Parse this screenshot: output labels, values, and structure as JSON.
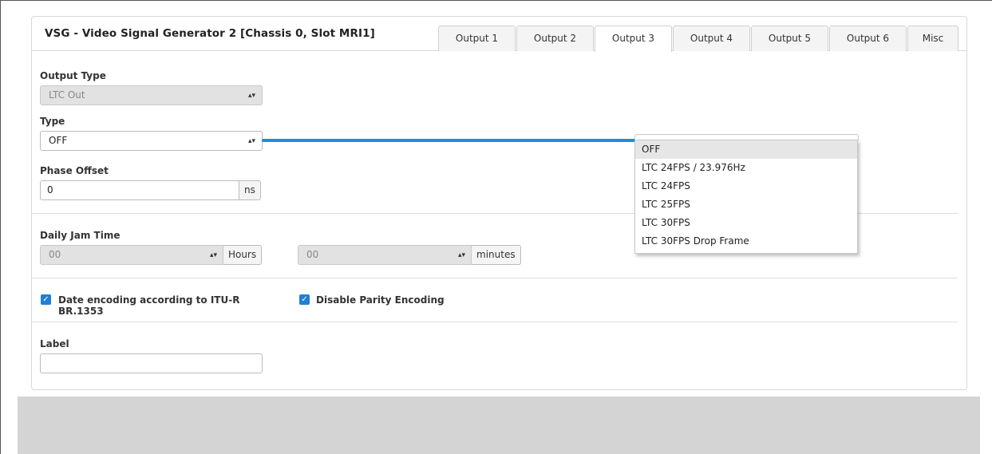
{
  "panel": {
    "title": "VSG - Video Signal Generator 2 [Chassis 0, Slot MRI1]"
  },
  "tabs": [
    {
      "label": "Output 1"
    },
    {
      "label": "Output 2"
    },
    {
      "label": "Output 3",
      "active": true
    },
    {
      "label": "Output 4"
    },
    {
      "label": "Output 5"
    },
    {
      "label": "Output 6"
    },
    {
      "label": "Misc"
    }
  ],
  "output_type": {
    "label": "Output Type",
    "value": "LTC Out",
    "disabled": true
  },
  "type": {
    "label": "Type",
    "value": "OFF",
    "options": [
      "OFF",
      "LTC 24FPS / 23.976Hz",
      "LTC 24FPS",
      "LTC 25FPS",
      "LTC 30FPS",
      "LTC 30FPS Drop Frame"
    ]
  },
  "phase_offset": {
    "label": "Phase Offset",
    "value": "0",
    "unit": "ns"
  },
  "daily_jam_time": {
    "label": "Daily Jam Time",
    "hours_value": "00",
    "hours_unit": "Hours",
    "minutes_value": "00",
    "minutes_unit": "minutes"
  },
  "checkboxes": {
    "date_encoding": {
      "label_line1": "Date encoding according to ITU-R",
      "label_line2": "BR.1353",
      "checked": true
    },
    "disable_parity": {
      "label": "Disable Parity Encoding",
      "checked": true
    }
  },
  "label_field": {
    "label": "Label",
    "value": ""
  },
  "colors": {
    "accent": "#1a8fe0",
    "checkbox": "#1f7fd6",
    "disabled_bg": "#e2e2e2",
    "footer_bg": "#d4d4d4"
  },
  "icons": {
    "select_arrow": "updown-arrow-icon",
    "check": "checkmark-icon"
  }
}
